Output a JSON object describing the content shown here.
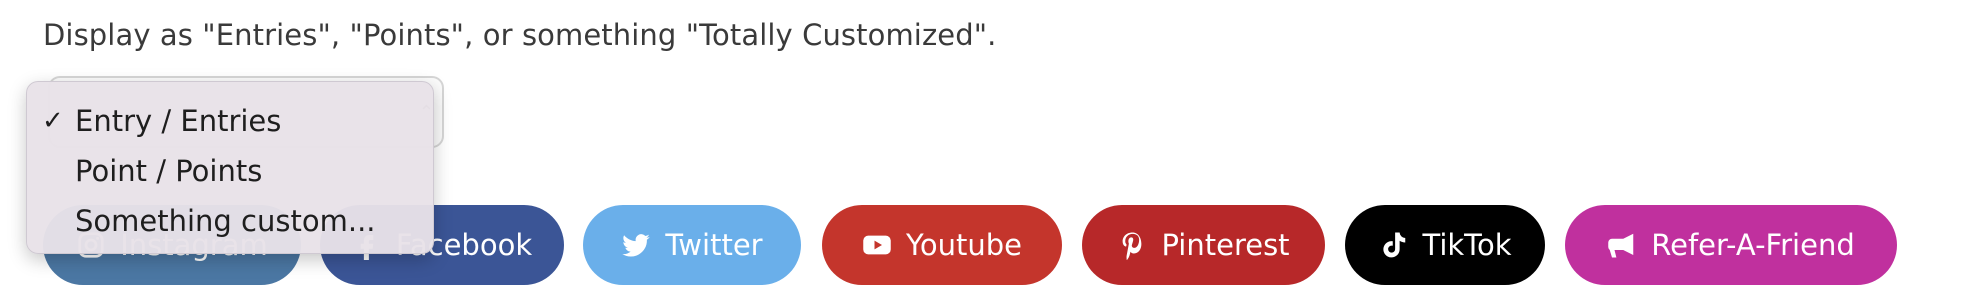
{
  "description": "Display as \"Entries\", \"Points\", or something \"Totally Customized\".",
  "select": {
    "options": [
      {
        "label": "Entry / Entries",
        "checked": true
      },
      {
        "label": "Point / Points",
        "checked": false
      },
      {
        "label": "Something custom...",
        "checked": false
      }
    ],
    "check_glyph": "✓"
  },
  "buttons": {
    "instagram": {
      "label": "Instagram",
      "icon": "instagram-icon",
      "color": "#4b77a3"
    },
    "facebook": {
      "label": "Facebook",
      "icon": "facebook-icon",
      "color": "#3b5596"
    },
    "twitter": {
      "label": "Twitter",
      "icon": "twitter-icon",
      "color": "#6aafea"
    },
    "youtube": {
      "label": "Youtube",
      "icon": "youtube-icon",
      "color": "#c4352c"
    },
    "pinterest": {
      "label": "Pinterest",
      "icon": "pinterest-icon",
      "color": "#b72829"
    },
    "tiktok": {
      "label": "TikTok",
      "icon": "tiktok-icon",
      "color": "#000000"
    },
    "refer": {
      "label": "Refer-A-Friend",
      "icon": "megaphone-icon",
      "color": "#c0309e"
    }
  }
}
